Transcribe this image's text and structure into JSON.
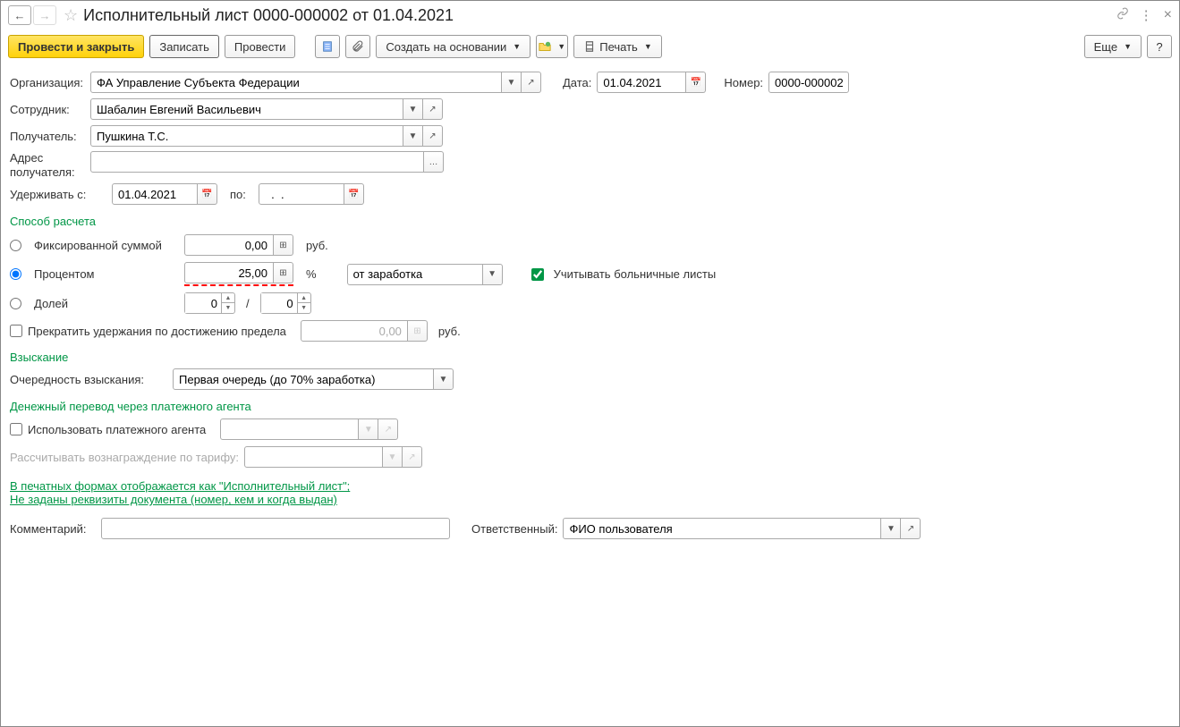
{
  "title": "Исполнительный лист 0000-000002 от 01.04.2021",
  "toolbar": {
    "post_close": "Провести и закрыть",
    "write": "Записать",
    "post": "Провести",
    "create_based": "Создать на основании",
    "print": "Печать",
    "more": "Еще",
    "help": "?"
  },
  "header": {
    "org_label": "Организация:",
    "org_value": "ФА Управление Субъекта Федерации",
    "date_label": "Дата:",
    "date_value": "01.04.2021",
    "number_label": "Номер:",
    "number_value": "0000-000002",
    "emp_label": "Сотрудник:",
    "emp_value": "Шабалин Евгений Васильевич",
    "recip_label": "Получатель:",
    "recip_value": "Пушкина Т.С.",
    "addr_label": "Адрес получателя:",
    "addr_value": "",
    "hold_from_label": "Удерживать с:",
    "hold_from_value": "01.04.2021",
    "hold_to_label": "по:",
    "hold_to_value": "  .  .    "
  },
  "calc": {
    "section": "Способ расчета",
    "fixed_label": "Фиксированной суммой",
    "fixed_value": "0,00",
    "fixed_unit": "руб.",
    "percent_label": "Процентом",
    "percent_value": "25,00",
    "percent_unit": "%",
    "percent_base": "от заработка",
    "sick_label": "Учитывать больничные листы",
    "fraction_label": "Долей",
    "fraction_num": "0",
    "fraction_den": "0",
    "fraction_sep": "/",
    "stop_label": "Прекратить удержания по достижению предела",
    "stop_value": "0,00",
    "stop_unit": "руб."
  },
  "collect": {
    "section": "Взыскание",
    "order_label": "Очередность взыскания:",
    "order_value": "Первая очередь (до 70% заработка)"
  },
  "agent": {
    "section": "Денежный перевод через платежного агента",
    "use_label": "Использовать платежного агента",
    "tariff_label": "Рассчитывать вознаграждение по тарифу:"
  },
  "link_text": "В печатных формах отображается как \"Исполнительный лист\"; Не заданы реквизиты документа (номер, кем и когда выдан)",
  "footer": {
    "comment_label": "Комментарий:",
    "comment_value": "",
    "resp_label": "Ответственный:",
    "resp_value": "ФИО пользователя"
  }
}
